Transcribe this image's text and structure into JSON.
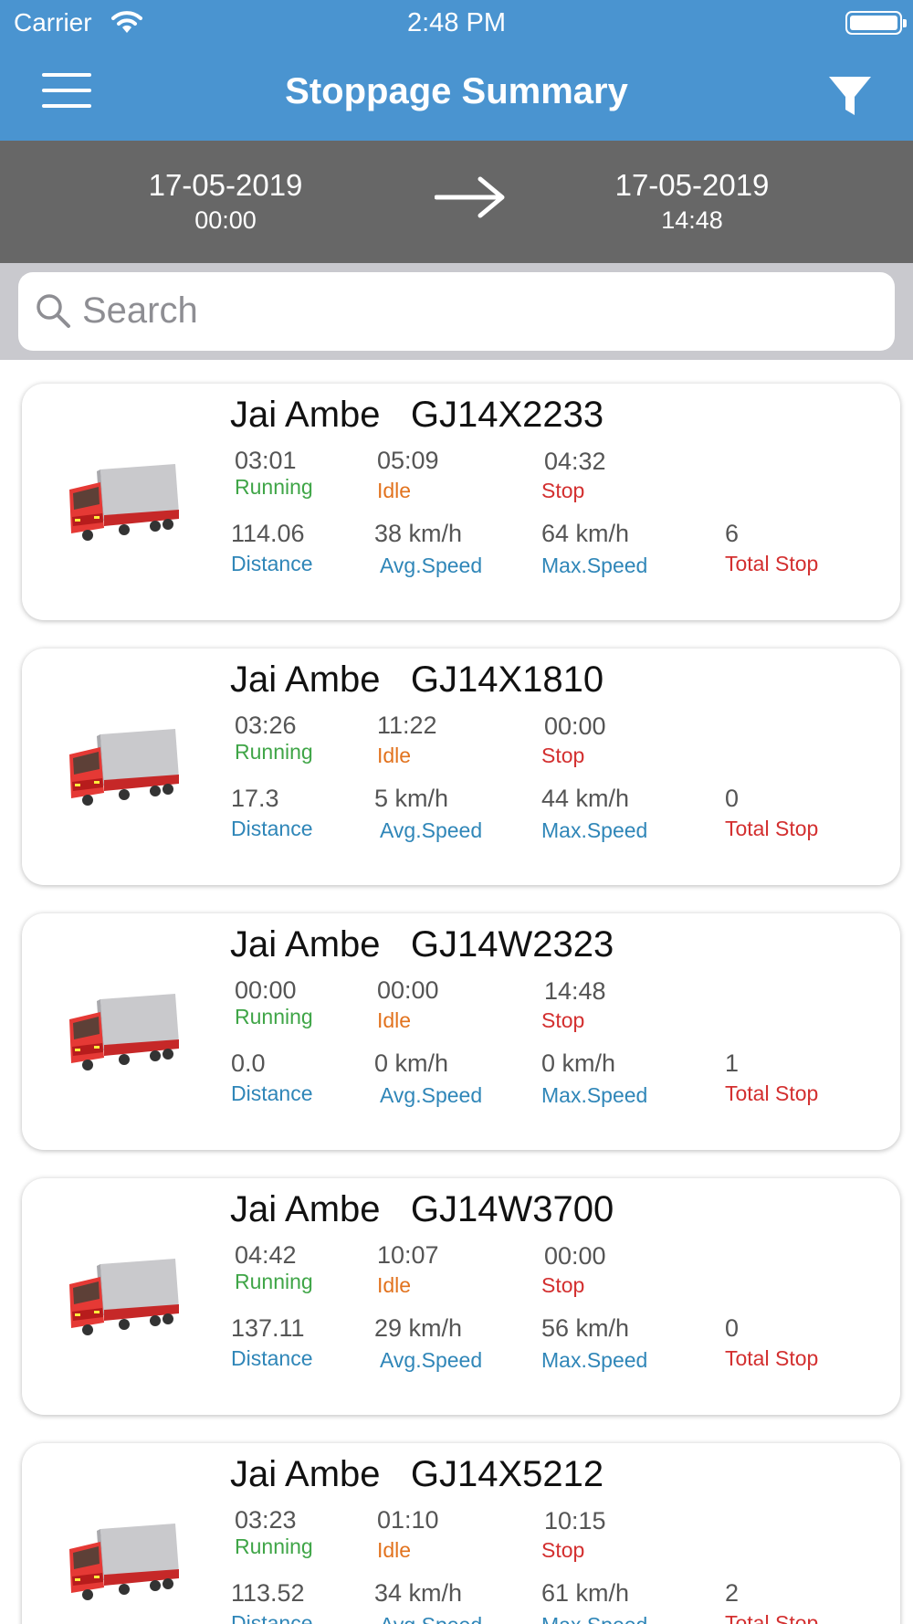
{
  "status_bar": {
    "carrier": "Carrier",
    "time": "2:48 PM"
  },
  "header": {
    "title": "Stoppage Summary"
  },
  "date_range": {
    "from_date": "17-05-2019",
    "from_time": "00:00",
    "to_date": "17-05-2019",
    "to_time": "14:48"
  },
  "search": {
    "placeholder": "Search",
    "value": ""
  },
  "labels": {
    "running": "Running",
    "idle": "Idle",
    "stop": "Stop",
    "distance": "Distance",
    "avg_speed": "Avg.Speed",
    "max_speed": "Max.Speed",
    "total_stop": "Total Stop"
  },
  "colors": {
    "header": "#4a94d0",
    "date_bar": "#676767",
    "running": "#3fa547",
    "idle": "#e2731f",
    "stop": "#d32f2f",
    "stat_label": "#2f86b8"
  },
  "vehicles": [
    {
      "name": "Jai Ambe   GJ14X2233",
      "running": "03:01",
      "idle": "05:09",
      "stop": "04:32",
      "distance": "114.06",
      "avg_speed": "38 km/h",
      "max_speed": "64 km/h",
      "total_stop": "6"
    },
    {
      "name": "Jai Ambe   GJ14X1810",
      "running": "03:26",
      "idle": "11:22",
      "stop": "00:00",
      "distance": "17.3",
      "avg_speed": "5 km/h",
      "max_speed": "44 km/h",
      "total_stop": "0"
    },
    {
      "name": "Jai Ambe   GJ14W2323",
      "running": "00:00",
      "idle": "00:00",
      "stop": "14:48",
      "distance": "0.0",
      "avg_speed": "0 km/h",
      "max_speed": "0 km/h",
      "total_stop": "1"
    },
    {
      "name": "Jai Ambe   GJ14W3700",
      "running": "04:42",
      "idle": "10:07",
      "stop": "00:00",
      "distance": "137.11",
      "avg_speed": "29 km/h",
      "max_speed": "56 km/h",
      "total_stop": "0"
    },
    {
      "name": "Jai Ambe   GJ14X5212",
      "running": "03:23",
      "idle": "01:10",
      "stop": "10:15",
      "distance": "113.52",
      "avg_speed": "34 km/h",
      "max_speed": "61 km/h",
      "total_stop": "2"
    }
  ]
}
